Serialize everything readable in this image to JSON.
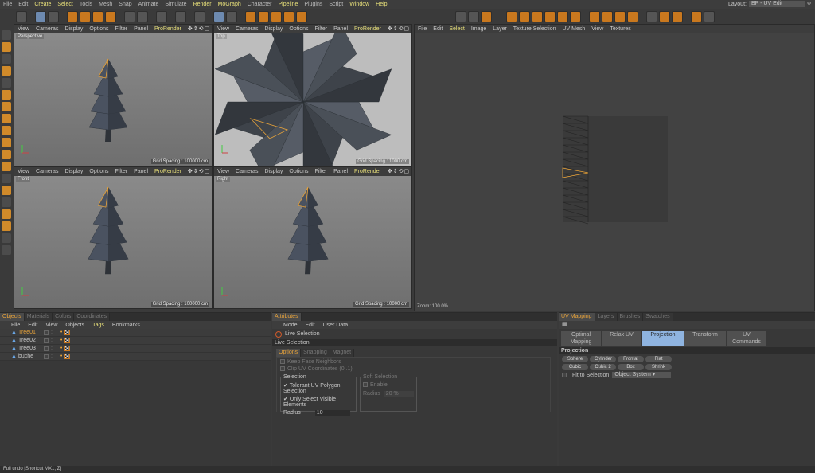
{
  "menu": [
    "File",
    "Edit",
    "Create",
    "Select",
    "Tools",
    "Mesh",
    "Snap",
    "Animate",
    "Simulate",
    "Render",
    "MoGraph",
    "Character",
    "Pipeline",
    "Plugins",
    "Script",
    "Window",
    "Help"
  ],
  "menu_highlight": [
    "Create",
    "Select",
    "Render",
    "MoGraph",
    "Pipeline",
    "Window",
    "Help"
  ],
  "layout": {
    "label": "Layout:",
    "value": "BP - UV Edit"
  },
  "viewport_menu": [
    "View",
    "Cameras",
    "Display",
    "Options",
    "Filter",
    "Panel"
  ],
  "viewport_render": "ProRender",
  "viewports": [
    {
      "name": "Perspective",
      "grid": ""
    },
    {
      "name": "Top",
      "grid": "Grid Spacing : 1000 cm"
    },
    {
      "name": "Front",
      "grid": "Grid Spacing : 100000 cm"
    },
    {
      "name": "Right",
      "grid": "Grid Spacing : 10000 cm"
    }
  ],
  "viewports_grid_perspective": "Grid Spacing : 100000 cm",
  "uv_menu": [
    "File",
    "Edit",
    "Select",
    "Image",
    "Layer",
    "Texture Selection",
    "UV Mesh",
    "View",
    "Textures"
  ],
  "uv_zoom": "Zoom: 100.0%",
  "objects": {
    "tabs": [
      "Objects",
      "Materials",
      "Colors",
      "Coordinates"
    ],
    "menu": [
      "File",
      "Edit",
      "View",
      "Objects",
      "Tags",
      "Bookmarks"
    ],
    "items": [
      "Tree01",
      "Tree02",
      "Tree03",
      "buche"
    ]
  },
  "attributes": {
    "tab": "Attributes",
    "menu": [
      "Mode",
      "Edit",
      "User Data"
    ],
    "tool": "Live Selection",
    "section": "Live Selection",
    "subtabs": [
      "Options",
      "Snapping",
      "Magnet"
    ],
    "keep": "Keep Face Neighbors",
    "clip": "Clip UV Coordinates (0..1)",
    "selection": "Selection",
    "tolerant": "Tolerant UV Polygon Selection",
    "only": "Only Select Visible Elements",
    "radius_label": "Radius",
    "radius": "10",
    "soft": "Soft Selection",
    "enable": "Enable",
    "soft_radius_label": "Radius",
    "soft_radius": "20 %"
  },
  "uvmap": {
    "tabs": [
      "UV Mapping",
      "Layers",
      "Brushes",
      "Swatches"
    ],
    "subtabs": [
      "Optimal Mapping",
      "Relax UV",
      "Projection",
      "Transform",
      "UV Commands"
    ],
    "section": "Projection",
    "buttons": [
      "Sphere",
      "Cylinder",
      "Frontal",
      "Flat",
      "Cubic",
      "Cubic 2",
      "Box",
      "Shrink"
    ],
    "fit": "Fit to Selection",
    "system": "Object System"
  },
  "status": "Full undo [Shortcut MX1, Z]",
  "colors": {
    "accent": "#e8a33a",
    "highlight": "#e8e07a",
    "selected": "#8fb4e0"
  }
}
